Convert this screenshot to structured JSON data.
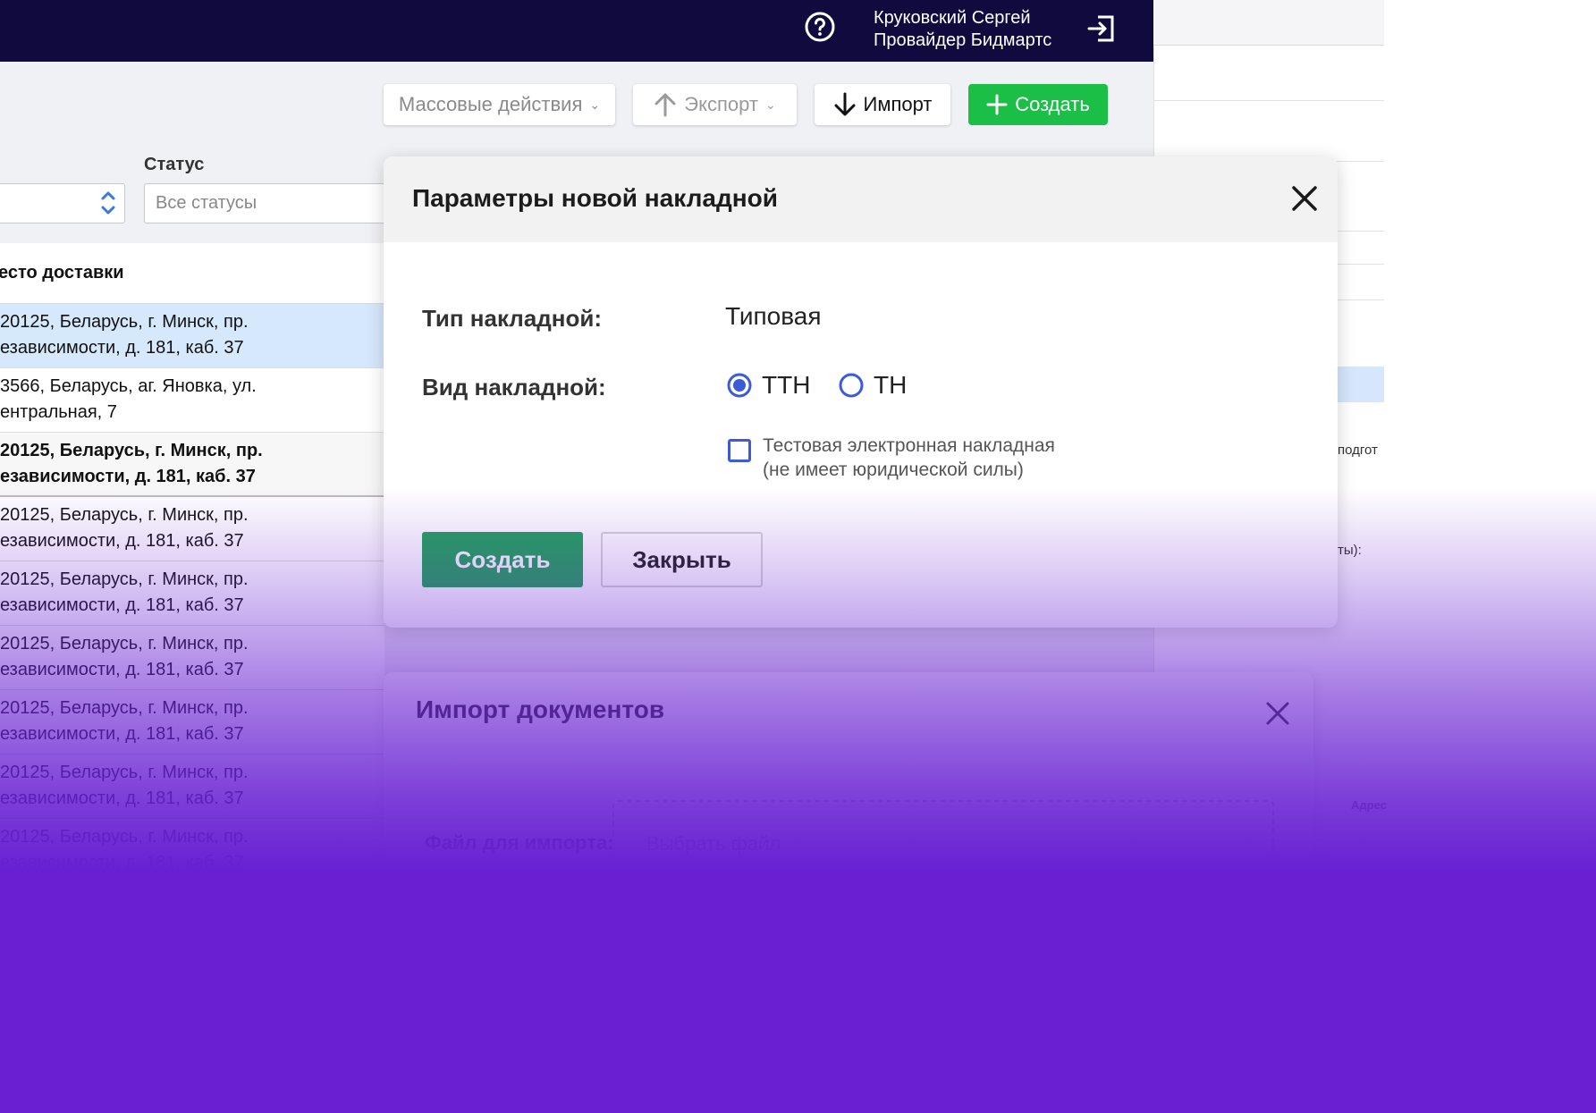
{
  "header": {
    "user_name": "Круковский Сергей",
    "user_org": "Провайдер Бидмартс",
    "icons": [
      "help-icon",
      "logout-icon"
    ]
  },
  "toolbar": {
    "mass_actions_label": "Массовые действия",
    "export_label": "Экспорт",
    "import_label": "Импорт",
    "create_label": "Создать"
  },
  "filters": {
    "status_label": "Статус",
    "status_value": "Все статусы"
  },
  "table": {
    "header": "есто доставки",
    "rows": [
      {
        "line1": "20125, Беларусь, г. Минск, пр.",
        "line2": "езависимости, д. 181, каб. 37"
      },
      {
        "line1": " 3566, Беларусь, аг. Яновка, ул.",
        "line2": "ентральная, 7"
      },
      {
        "line1": "20125, Беларусь, г. Минск, пр.",
        "line2": "езависимости, д. 181, каб. 37"
      },
      {
        "line1": "20125, Беларусь, г. Минск, пр.",
        "line2": "езависимости, д. 181, каб. 37"
      },
      {
        "line1": "20125, Беларусь, г. Минск, пр.",
        "line2": "езависимости, д. 181, каб. 37"
      },
      {
        "line1": "20125, Беларусь, г. Минск, пр.",
        "line2": "езависимости, д. 181, каб. 37"
      },
      {
        "line1": "20125, Беларусь, г. Минск, пр.",
        "line2": "езависимости, д. 181, каб. 37"
      },
      {
        "line1": "20125, Беларусь, г. Минск, пр.",
        "line2": "езависимости, д. 181, каб. 37"
      },
      {
        "line1": "20125, Беларусь, г. Минск, пр.",
        "line2": "езависимости, д. 181, каб. 37"
      }
    ]
  },
  "right_panel": {
    "text1": "подгот",
    "text2": "ты):",
    "text3": "Адрес"
  },
  "modal": {
    "title": "Параметры новой накладной",
    "type_label": "Тип накладной:",
    "type_value": "Типовая",
    "kind_label": "Вид накладной:",
    "kind_options": [
      "ТТН",
      "ТН"
    ],
    "kind_selected": "ТТН",
    "test_checkbox_line1": "Тестовая электронная накладная",
    "test_checkbox_line2": "(не имеет юридической силы)",
    "test_checked": false,
    "create_button": "Создать",
    "close_button": "Закрыть"
  },
  "import_modal": {
    "title": "Импорт документов",
    "file_label": "Файл для импорта:",
    "file_placeholder": "Выбрать файл"
  },
  "colors": {
    "topbar": "#100a3e",
    "accent_green": "#1bbe47",
    "modal_green": "#22a35a",
    "radio_blue": "#3b5bdb",
    "overlay_purple": "#6820d2"
  }
}
